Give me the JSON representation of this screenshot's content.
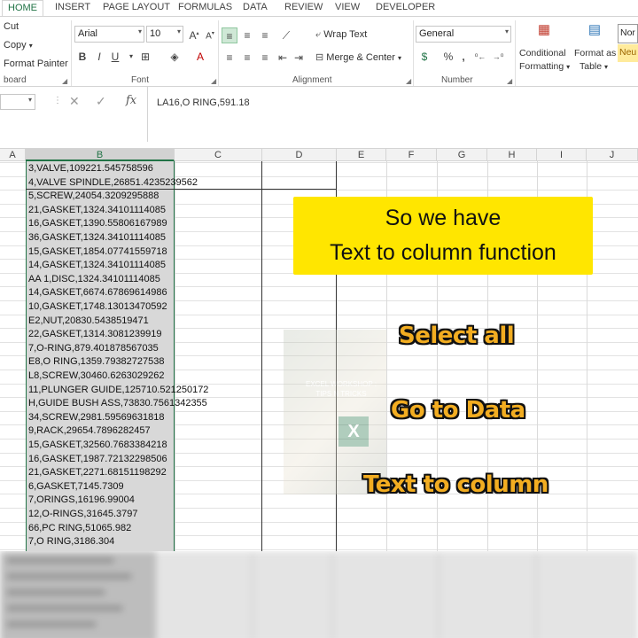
{
  "tabs": [
    "HOME",
    "INSERT",
    "PAGE LAYOUT",
    "FORMULAS",
    "DATA",
    "REVIEW",
    "VIEW",
    "DEVELOPER"
  ],
  "clipboard": {
    "cut": "Cut",
    "copy": "Copy",
    "format_painter": "Format Painter",
    "label": "board"
  },
  "font": {
    "name": "Arial",
    "size": "10",
    "label": "Font",
    "bold": "B",
    "italic": "I",
    "underline": "U"
  },
  "alignment": {
    "wrap_text": "Wrap Text",
    "merge_center": "Merge & Center",
    "label": "Alignment"
  },
  "number": {
    "format": "General",
    "percent": "%",
    "comma": ",",
    "label": "Number"
  },
  "styles": {
    "conditional": "Conditional",
    "formatting": "Formatting",
    "format_as": "Format as",
    "table": "Table",
    "normal": "Nor",
    "neutral": "Neu"
  },
  "formula_bar": {
    "fx": "fx",
    "content": "LA16,O RING,591.18"
  },
  "columns": [
    "A",
    "B",
    "C",
    "D",
    "E",
    "F",
    "G",
    "H",
    "I",
    "J"
  ],
  "cells": [
    "3,VALVE,109221.545758596",
    "4,VALVE SPINDLE,26851.4235239562",
    "5,SCREW,24054.3209295888",
    "21,GASKET,1324.34101114085",
    "16,GASKET,1390.55806167989",
    "36,GASKET,1324.34101114085",
    "15,GASKET,1854.07741559718",
    "14,GASKET,1324.34101114085",
    "AA 1,DISC,1324.34101114085",
    "14,GASKET,6674.67869614986",
    "10,GASKET,1748.13013470592",
    "E2,NUT,20830.5438519471",
    "22,GASKET,1314.3081239919",
    "7,O-RING,879.401878567035",
    "E8,O RING,1359.79382727538",
    "L8,SCREW,30460.6263029262",
    "11,PLUNGER GUIDE,125710.521250172",
    "H,GUIDE BUSH ASS,73830.7561342355",
    "34,SCREW,2981.59569631818",
    "9,RACK,29654.7896282457",
    "15,GASKET,32560.7683384218",
    "16,GASKET,1987.72132298506",
    "21,GASKET,2271.68151198292",
    "6,GASKET,7145.7309",
    "7,ORINGS,16196.99004",
    "12,O-RINGS,31645.3797",
    "66,PC RING,51065.982",
    "7,O RING,3186.304"
  ],
  "watermark": {
    "line1": "EXCEL WORKSHOP :",
    "line2": "TIPS N TRICKS",
    "logo": "X"
  },
  "overlay": {
    "title_line1": "So we have",
    "title_line2": "Text to column function",
    "step1": "Select all",
    "step2": "Go to Data",
    "step3": "Text to column"
  },
  "colors": {
    "excel_green": "#217346",
    "callout_yellow": "#ffe600",
    "caption_orange": "#f2ad21"
  }
}
